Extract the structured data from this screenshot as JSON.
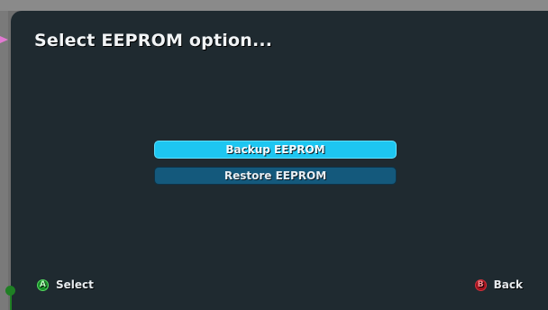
{
  "title": "Select EEPROM option...",
  "menu": {
    "options": [
      {
        "label": "Backup EEPROM",
        "selected": true
      },
      {
        "label": "Restore EEPROM",
        "selected": false
      }
    ]
  },
  "footer": {
    "select": {
      "button": "A",
      "label": "Select"
    },
    "back": {
      "button": "B",
      "label": "Back"
    }
  },
  "colors": {
    "panel": "#1f2a30",
    "selected": "#1dc6f1",
    "normal": "#14597c",
    "a_button": "#1a8f2a",
    "b_button": "#a0121d"
  }
}
